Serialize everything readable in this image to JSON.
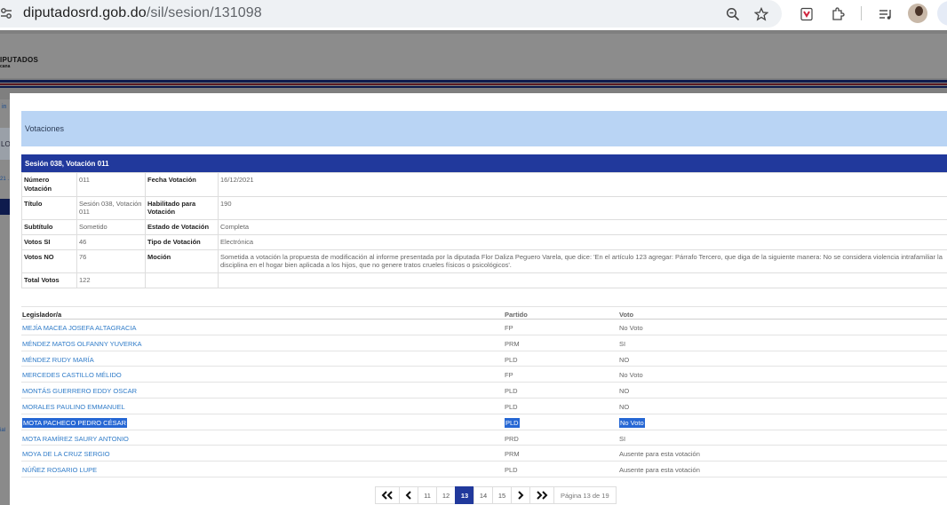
{
  "browser": {
    "url_domain": "diputadosrd.gob.do",
    "url_path": "/sil/sesion/131098",
    "icons": [
      "tune-icon",
      "zoom-icon",
      "star-icon",
      "shield-extension-icon",
      "puzzle-icon",
      "media-queue-icon",
      "profile-avatar"
    ]
  },
  "background_page": {
    "logo_main": "IPUTADOS",
    "logo_sub": "cana",
    "sliver_a": "in",
    "sliver_b": "LO",
    "sliver_c": "21 .",
    "sliver_e": "ial"
  },
  "modal": {
    "title": "Votaciones",
    "session_title": "Sesión 038, Votación 011",
    "info": {
      "numero_label": "Número Votación",
      "numero_value": "011",
      "fecha_label": "Fecha Votación",
      "fecha_value": "16/12/2021",
      "titulo_label": "Título",
      "titulo_value": "Sesión 038, Votación 011",
      "habilitado_label": "Habilitado para Votación",
      "habilitado_value": "190",
      "subtitulo_label": "Subtítulo",
      "subtitulo_value": "Sometido",
      "estado_label": "Estado de Votación",
      "estado_value": "Completa",
      "si_label": "Votos SI",
      "si_value": "46",
      "tipo_label": "Tipo de Votación",
      "tipo_value": "Electrónica",
      "no_label": "Votos NO",
      "no_value": "76",
      "mocion_label": "Moción",
      "mocion_value": "Sometida a votación la propuesta de modificación al informe presentada por la diputada Flor Daliza Peguero Varela, que dice: 'En el artículo 123 agregar: Párrafo Tercero, que diga de la siguiente manera: No se considera violencia intrafamiliar la disciplina en el hogar bien aplicada a los hijos, que no genere tratos crueles físicos o psicológicos'.",
      "total_label": "Total Votos",
      "total_value": "122"
    },
    "votes_header": {
      "legislador": "Legislador/a",
      "partido": "Partido",
      "voto": "Voto"
    },
    "votes": [
      {
        "name": "MEJÍA MACEA JOSEFA ALTAGRACIA",
        "party": "FP",
        "vote": "No Voto"
      },
      {
        "name": "MÉNDEZ MATOS OLFANNY YUVERKA",
        "party": "PRM",
        "vote": "SI"
      },
      {
        "name": "MÉNDEZ RUDY MARÍA",
        "party": "PLD",
        "vote": "NO"
      },
      {
        "name": "MERCEDES CASTILLO MÉLIDO",
        "party": "FP",
        "vote": "No Voto"
      },
      {
        "name": "MONTÁS GUERRERO EDDY OSCAR",
        "party": "PLD",
        "vote": "NO"
      },
      {
        "name": "MORALES PAULINO EMMANUEL",
        "party": "PLD",
        "vote": "NO"
      },
      {
        "name": "MOTA PACHECO PEDRO CÉSAR",
        "party": "PLD",
        "vote": "No Voto"
      },
      {
        "name": "MOTA RAMÍREZ SAURY ANTONIO",
        "party": "PRD",
        "vote": "SI"
      },
      {
        "name": "MOYA DE LA CRUZ SERGIO",
        "party": "PRM",
        "vote": "Ausente para esta votación"
      },
      {
        "name": "NÚÑEZ ROSARIO LUPE",
        "party": "PLD",
        "vote": "Ausente para esta votación"
      }
    ],
    "pagination": {
      "first": "«",
      "prev": "‹",
      "pages": [
        "11",
        "12",
        "13",
        "14",
        "15"
      ],
      "current": "13",
      "next": "›",
      "last": "»",
      "info": "Página 13 de 19"
    }
  }
}
